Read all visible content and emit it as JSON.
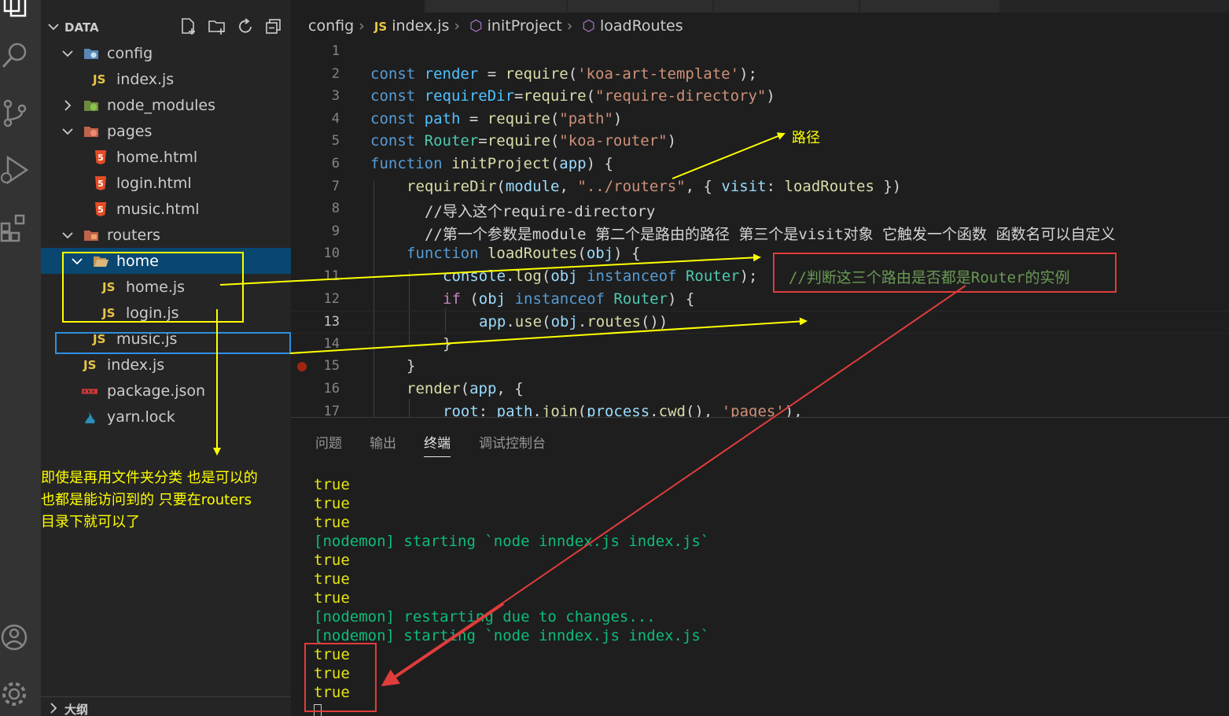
{
  "sidebar": {
    "title": "DATA",
    "items": [
      {
        "label": "config",
        "icon": "folder-config-icon"
      },
      {
        "label": "index.js",
        "icon": "js-file-icon"
      },
      {
        "label": "node_modules",
        "icon": "folder-node-icon"
      },
      {
        "label": "pages",
        "icon": "folder-pages-icon"
      },
      {
        "label": "home.html",
        "icon": "html-file-icon"
      },
      {
        "label": "login.html",
        "icon": "html-file-icon"
      },
      {
        "label": "music.html",
        "icon": "html-file-icon"
      },
      {
        "label": "routers",
        "icon": "folder-routers-icon"
      },
      {
        "label": "home",
        "icon": "folder-open-icon"
      },
      {
        "label": "home.js",
        "icon": "js-file-icon"
      },
      {
        "label": "login.js",
        "icon": "js-file-icon"
      },
      {
        "label": "music.js",
        "icon": "js-file-icon"
      },
      {
        "label": "index.js",
        "icon": "js-file-icon"
      },
      {
        "label": "package.json",
        "icon": "npm-file-icon"
      },
      {
        "label": "yarn.lock",
        "icon": "yarn-file-icon"
      }
    ],
    "js_badge": "JS",
    "outline_label": "大纲",
    "note_line1": "即使是再用文件夹分类 也是可以的",
    "note_line2": "也都是能访问到的  只要在routers",
    "note_line3": "目录下就可以了"
  },
  "breadcrumb": {
    "folder": "config",
    "js_badge": "JS",
    "file": "index.js",
    "fn1": "initProject",
    "fn2": "loadRoutes"
  },
  "code": {
    "line_numbers": [
      "1",
      "2",
      "3",
      "4",
      "5",
      "6",
      "7",
      "8",
      "9",
      "10",
      "11",
      "12",
      "13",
      "14",
      "15",
      "16",
      "17"
    ],
    "active_line": 13,
    "l2": {
      "k": "const",
      "v": "render",
      "op": " = ",
      "f": "require",
      "s": "'koa-art-template'",
      "end": ");"
    },
    "l3": {
      "k": "const",
      "v": "requireDir",
      "op": "=",
      "f": "require",
      "s": "\"require-directory\"",
      "end": ")"
    },
    "l4": {
      "k": "const",
      "v": "path",
      "op": " = ",
      "f": "require",
      "s": "\"path\"",
      "end": ")"
    },
    "l5": {
      "k": "const",
      "v": "Router",
      "op": "=",
      "f": "require",
      "s": "\"koa-router\"",
      "end": ")"
    },
    "l6": {
      "k": "function",
      "f": "initProject",
      "p": "app",
      "end": ") {"
    },
    "l7": {
      "f": "requireDir",
      "p": "module",
      "s": "\"../routers\"",
      "mid": ", { ",
      "prop": "visit",
      "colon": ": ",
      "f2": "loadRoutes",
      "end": " })"
    },
    "l8": "//导入这个require-directory",
    "l9": "//第一个参数是module 第二个是路由的路径 第三个是visit对象 它触发一个函数 函数名可以自定义",
    "l10": {
      "k": "function",
      "f": "loadRoutes",
      "p": "obj",
      "end": ") {"
    },
    "l11": {
      "c": "console",
      "dot": ".",
      "f": "log",
      "p": "obj",
      "k": "instanceof",
      "cls": "Router",
      "end": ");"
    },
    "l12": {
      "k": "if",
      "p": "obj",
      "k2": "instanceof",
      "cls": "Router",
      "end": ") {"
    },
    "l13": {
      "p": "app",
      "f": "use",
      "p2": "obj",
      "prop": "routes",
      "end": "())"
    },
    "l14": "}",
    "l15": "}",
    "l16": {
      "f": "render",
      "p": "app",
      "end": ", {"
    },
    "l17": {
      "prop": "root",
      "colon": ": ",
      "p": "path",
      "f": "join",
      "p2": "process",
      "f2": "cwd",
      "s": "'pages'",
      "end": "),"
    }
  },
  "panel": {
    "tabs": [
      "问题",
      "输出",
      "终端",
      "调试控制台"
    ],
    "active_tab": "终端",
    "terminal": [
      {
        "text": "true",
        "kind": "true"
      },
      {
        "text": "true",
        "kind": "true"
      },
      {
        "text": "true",
        "kind": "true"
      },
      {
        "text": "[nodemon] starting `node inndex.js index.js`",
        "kind": "nodemon"
      },
      {
        "text": "true",
        "kind": "true"
      },
      {
        "text": "true",
        "kind": "true"
      },
      {
        "text": "true",
        "kind": "true"
      },
      {
        "text": "[nodemon] restarting due to changes...",
        "kind": "nodemon"
      },
      {
        "text": "[nodemon] starting `node inndex.js index.js`",
        "kind": "nodemon"
      },
      {
        "text": "true",
        "kind": "true"
      },
      {
        "text": "true",
        "kind": "true"
      },
      {
        "text": "true",
        "kind": "true"
      }
    ]
  },
  "annotations": {
    "path_label": "路径",
    "red_note": "//判断这三个路由是否都是Router的实例"
  },
  "colors": {
    "yellow": "#ffff00",
    "red": "#e03c3c",
    "blue": "#2f8fe0",
    "selection": "#094771"
  }
}
